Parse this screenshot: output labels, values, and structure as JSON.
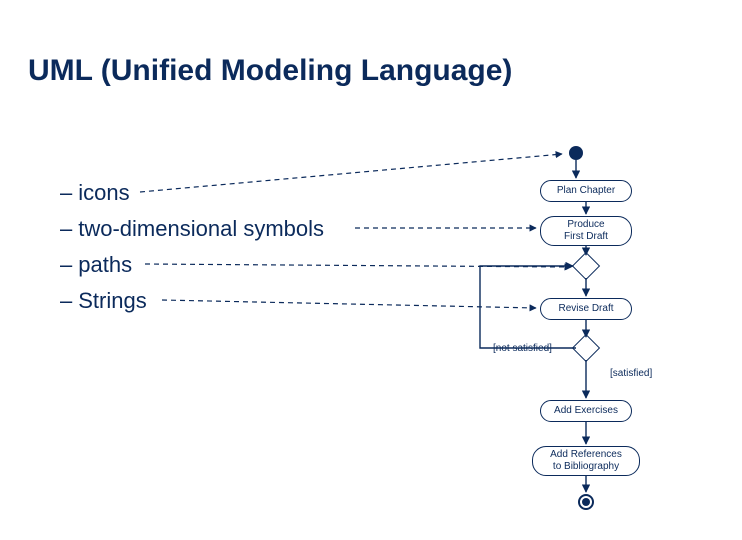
{
  "title": "UML (Unified Modeling Language)",
  "bullets": {
    "icons": "icons",
    "two_dimensional": "two-dimensional symbols",
    "paths": "paths",
    "strings": "Strings"
  },
  "activities": {
    "plan_chapter": "Plan Chapter",
    "produce_first_draft": "Produce\nFirst Draft",
    "revise_draft": "Revise Draft",
    "add_exercises": "Add Exercises",
    "add_references": "Add References\nto Bibliography"
  },
  "guards": {
    "not_satisfied": "[not satisfied]",
    "satisfied": "[satisfied]"
  }
}
